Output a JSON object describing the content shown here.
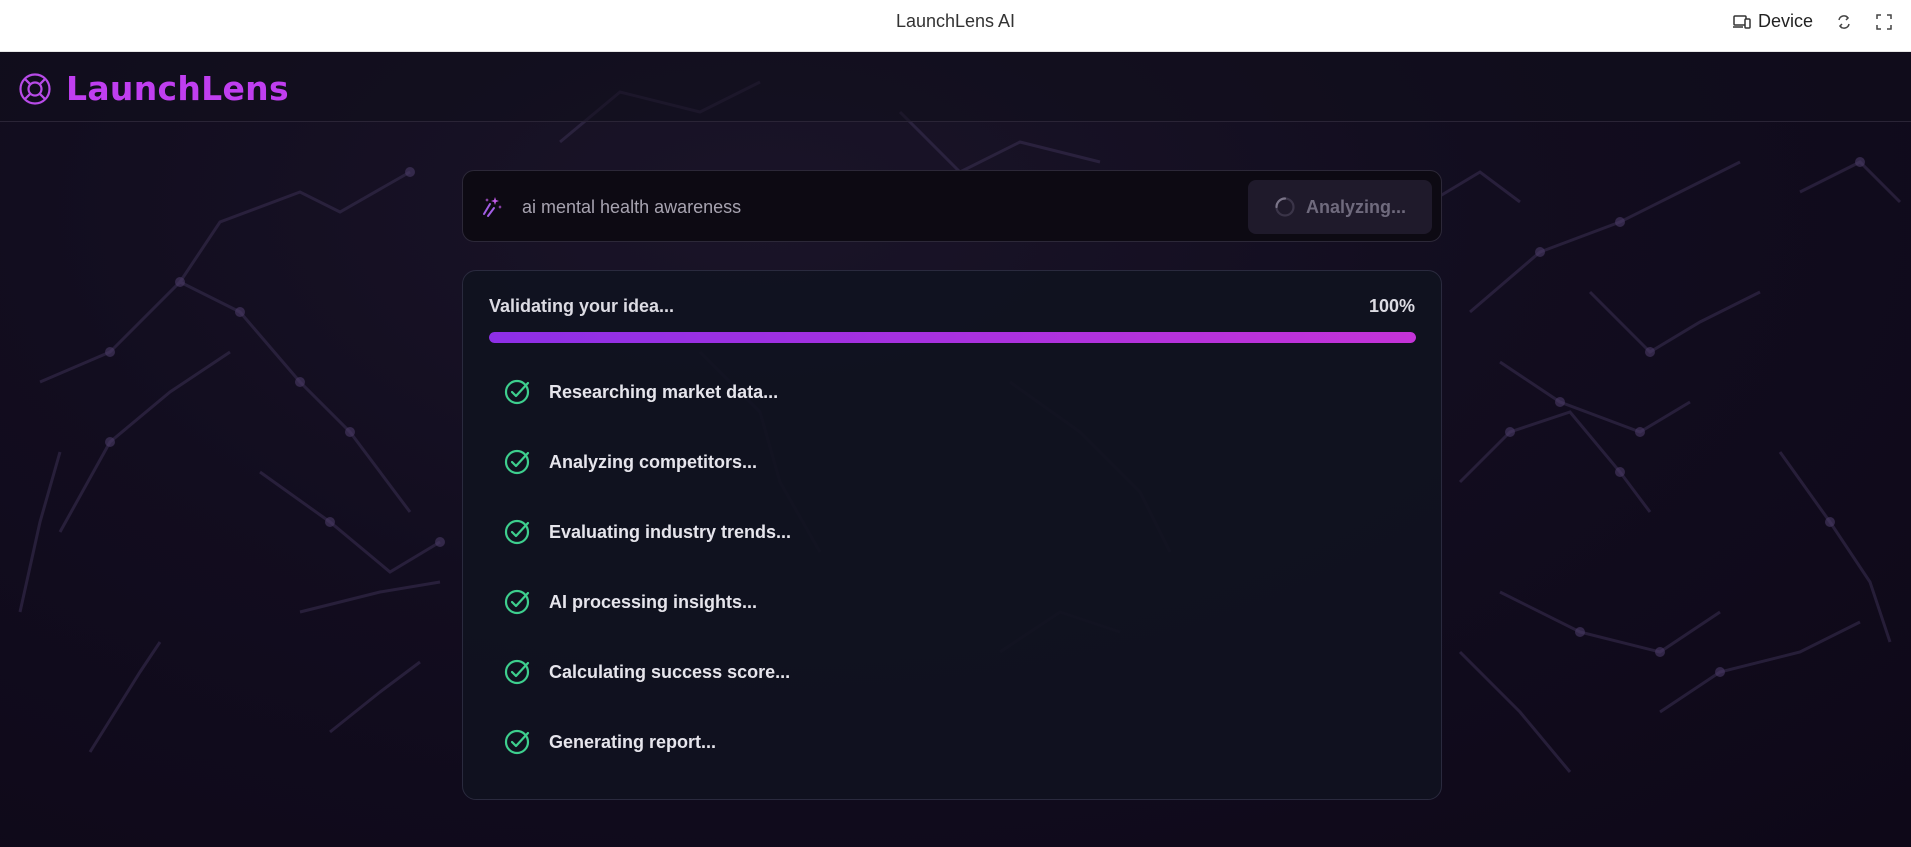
{
  "window": {
    "title": "LaunchLens AI",
    "device_label": "Device"
  },
  "header": {
    "brand": "LaunchLens"
  },
  "search": {
    "value": "ai mental health awareness",
    "button_label": "Analyzing..."
  },
  "progress": {
    "title": "Validating your idea...",
    "percent_label": "100%",
    "percent": 100,
    "steps": [
      {
        "label": "Researching market data...",
        "status": "done"
      },
      {
        "label": "Analyzing competitors...",
        "status": "done"
      },
      {
        "label": "Evaluating industry trends...",
        "status": "done"
      },
      {
        "label": "AI processing insights...",
        "status": "done"
      },
      {
        "label": "Calculating success score...",
        "status": "done"
      },
      {
        "label": "Generating report...",
        "status": "done"
      }
    ]
  },
  "colors": {
    "brand": "#c03ef0",
    "check": "#3ecf8e",
    "progress_start": "#8d2fe6",
    "progress_end": "#c433d8",
    "background": "#120d1f"
  },
  "icons": {
    "logo": "lifebuoy-icon",
    "search": "sparkles-icon",
    "button": "spinner-icon",
    "step": "check-circle-icon",
    "device": "devices-icon",
    "rotate": "rotate-icon",
    "fullscreen": "fullscreen-icon"
  }
}
